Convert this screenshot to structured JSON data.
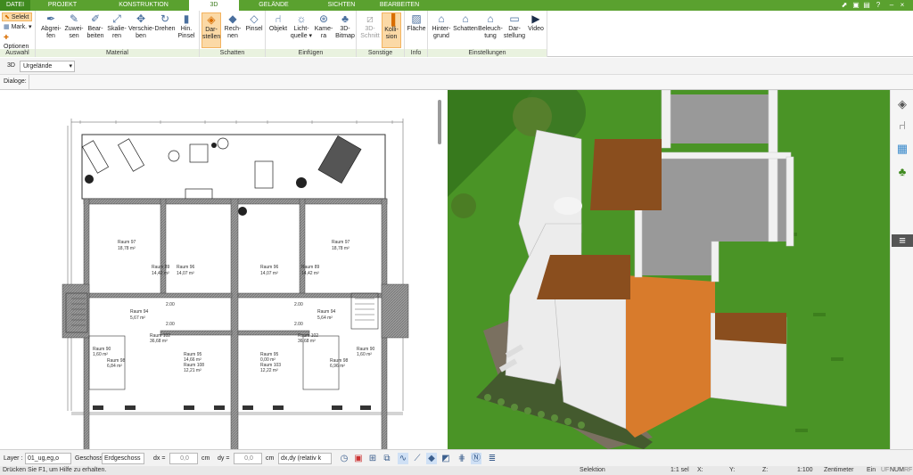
{
  "tabs": [
    {
      "label": "DATEI"
    },
    {
      "label": "PROJEKT"
    },
    {
      "label": "KONSTRUKTION"
    },
    {
      "label": "3D"
    },
    {
      "label": "GELÄNDE"
    },
    {
      "label": "SICHTEN"
    },
    {
      "label": "BEARBEITEN"
    }
  ],
  "auswahl": {
    "select": "Selekt",
    "mark": "Mark.",
    "options": "Optionen",
    "label": "Auswahl"
  },
  "material": {
    "label": "Material",
    "buttons": [
      {
        "label": "Abgrei-\nfen"
      },
      {
        "label": "Zuwei-\nsen"
      },
      {
        "label": "Bear-\nbeiten"
      },
      {
        "label": "Skalie-\nren"
      },
      {
        "label": "Verschie-\nben"
      },
      {
        "label": "Drehen"
      },
      {
        "label": "Hin.\nPinsel"
      }
    ]
  },
  "schatten": {
    "label": "Schatten",
    "buttons": [
      {
        "label": "Dar-\nstellen"
      },
      {
        "label": "Rech-\nnen"
      },
      {
        "label": "Pinsel"
      }
    ]
  },
  "einfuegen": {
    "label": "Einfügen",
    "buttons": [
      {
        "label": "Objekt"
      },
      {
        "label": "Licht-\nquelle ▾"
      },
      {
        "label": "Kame-\nra"
      },
      {
        "label": "3D-\nBitmap"
      }
    ]
  },
  "sonstige": {
    "label": "Sonstige",
    "buttons": [
      {
        "label": "3D-\nSchnitt"
      },
      {
        "label": "Kolli-\nsion"
      }
    ]
  },
  "info": {
    "label": "Info",
    "buttons": [
      {
        "label": "Fläche"
      }
    ]
  },
  "einstellungen": {
    "label": "Einstellungen",
    "buttons": [
      {
        "label": "Hinter-\ngrund"
      },
      {
        "label": "Schatten"
      },
      {
        "label": "Beleuch-\ntung"
      },
      {
        "label": "Dar-\nstellung"
      },
      {
        "label": "Video"
      }
    ]
  },
  "toolbar2": {
    "mode": "3D",
    "dropdown": "Urgelände"
  },
  "toolbar3": {
    "label": "Dialoge:"
  },
  "rooms": [
    {
      "name": "Raum 97",
      "area": "18,78 m²"
    },
    {
      "name": "Raum 89",
      "area": "14,42 m²"
    },
    {
      "name": "Raum 96",
      "area": "14,07 m²"
    },
    {
      "name": "Raum 96",
      "area": "14,07 m²"
    },
    {
      "name": "Raum 89",
      "area": "14,42 m²"
    },
    {
      "name": "Raum 97",
      "area": "18,78 m²"
    },
    {
      "name": "Raum 94",
      "area": "5,67 m²"
    },
    {
      "name": "Raum 94",
      "area": "5,64 m²"
    },
    {
      "name": "Raum 95",
      "area": "14,66 m²"
    },
    {
      "name": "Raum 108",
      "area": "12,21 m²"
    },
    {
      "name": "Raum 95",
      "area": "0,00 m²"
    },
    {
      "name": "Raum 103",
      "area": "12,22 m²"
    },
    {
      "name": "Raum 90",
      "area": "1,60 m²"
    },
    {
      "name": "Raum 90",
      "area": "1,60 m²"
    },
    {
      "name": "Raum 102",
      "area": "36,68 m²"
    },
    {
      "name": "Raum 102",
      "area": "36,68 m²"
    },
    {
      "name": "Raum 98",
      "area": "6,84 m²"
    },
    {
      "name": "Raum 98",
      "area": "6,96 m²"
    }
  ],
  "dims": [
    "2.00",
    "2.00",
    "2.00",
    "2.00"
  ],
  "statusbar": {
    "layer_label": "Layer :",
    "layer_value": "01_ug,eg,o",
    "geschoss_label": "Geschoss :",
    "geschoss_value": "Erdgeschoss",
    "dx_label": "dx =",
    "dx_value": "0,0",
    "dx_unit": "cm",
    "dy_label": "dy =",
    "dy_value": "0,0",
    "dy_unit": "cm",
    "mode_value": "dx,dy (relativ k"
  },
  "status2": {
    "hint": "Drücken Sie F1, um Hilfe zu erhalten.",
    "selection": "Selektion",
    "ratio": "1:1 sel",
    "x": "X:",
    "y": "Y:",
    "z": "Z:",
    "scale": "1:100",
    "unit": "Zentimeter",
    "ein": "Ein",
    "uf": "UF",
    "num": "NUM",
    "rf": "RF"
  },
  "colors": {
    "accent": "#5aa12f",
    "highlight": "#fbd9a6",
    "grass": "#3d8a1c",
    "facade": "#d87b2c"
  }
}
